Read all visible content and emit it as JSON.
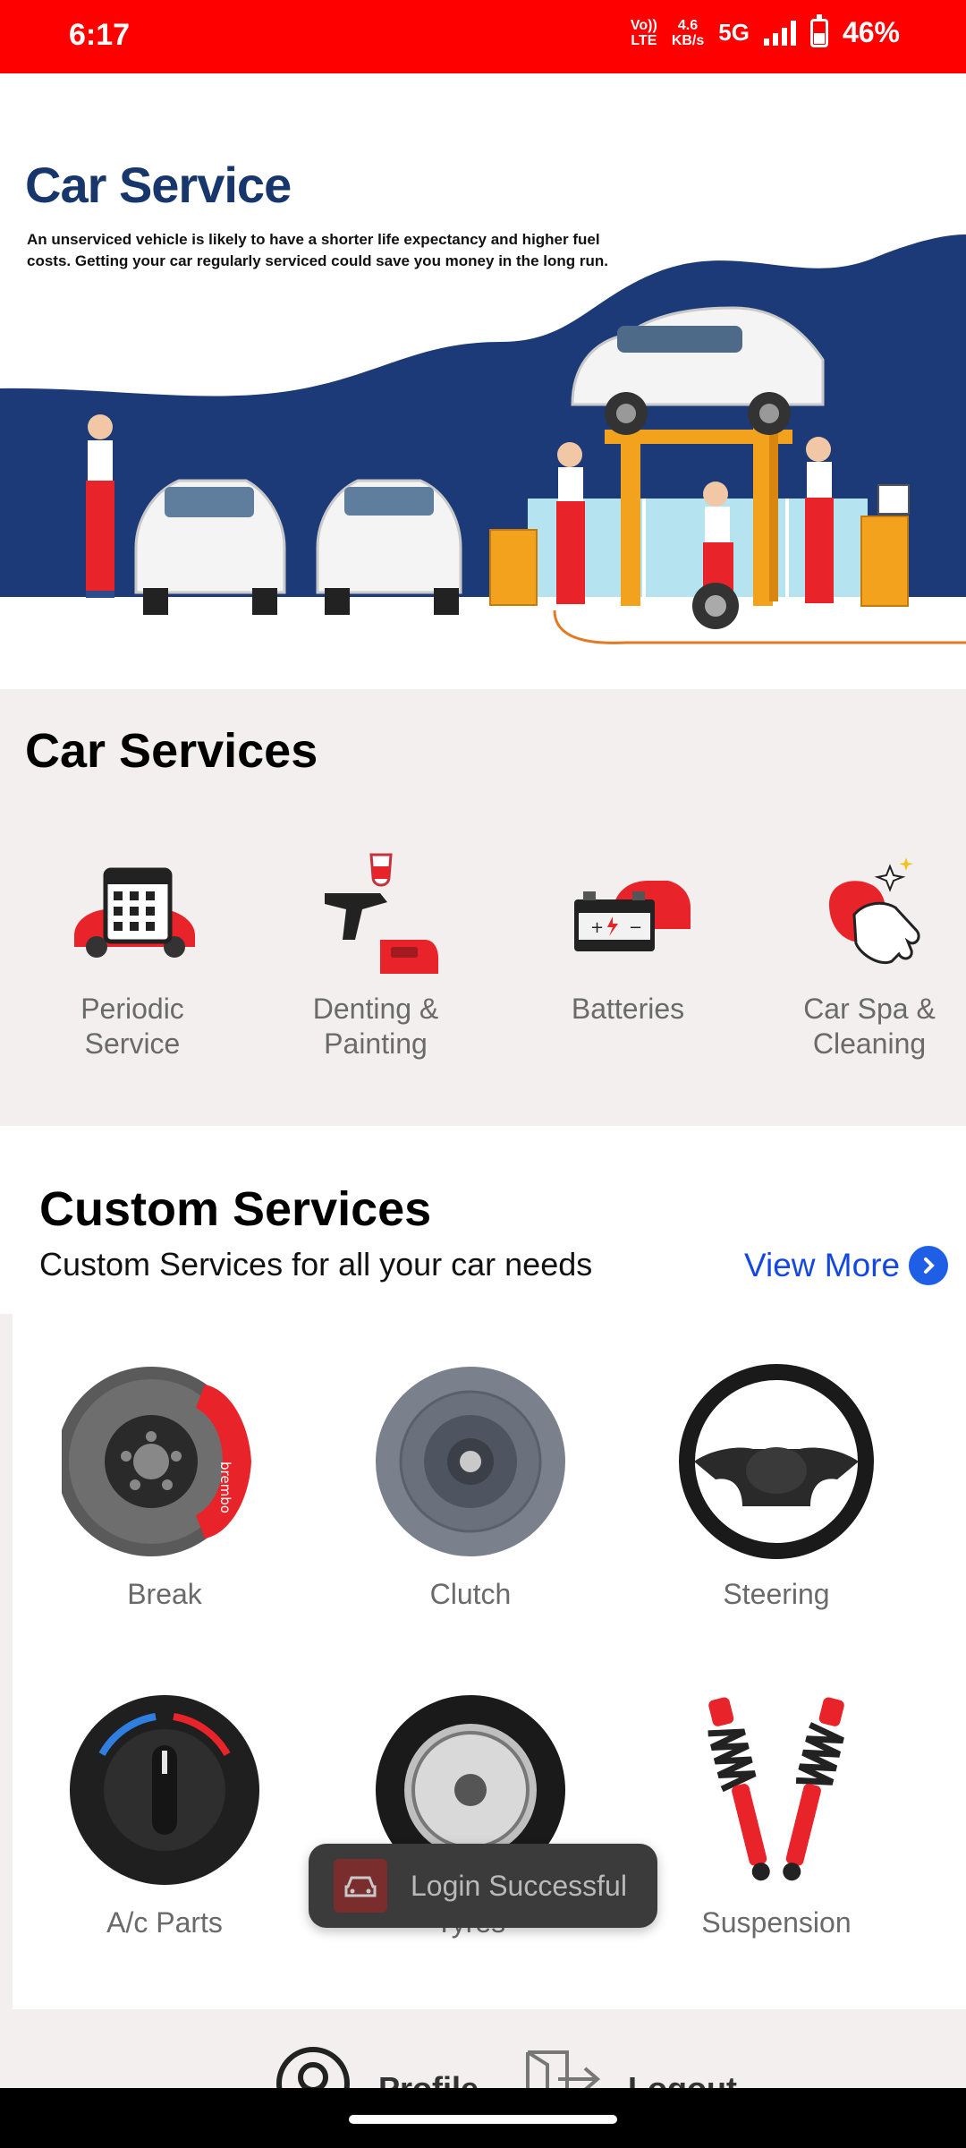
{
  "status_bar": {
    "time": "6:17",
    "volte_top": "Vo))",
    "volte_bottom": "LTE",
    "speed_top": "4.6",
    "speed_bottom": "KB/s",
    "network": "5G",
    "battery": "46%"
  },
  "banner": {
    "title": "Car Service",
    "subtitle": "An unserviced vehicle is likely to have a shorter life expectancy and higher fuel costs. Getting your car regularly serviced could save you money in the long run."
  },
  "car_services": {
    "title": "Car Services",
    "items": [
      {
        "label": "Periodic Service",
        "icon": "calendar-car-icon"
      },
      {
        "label": "Denting & Painting",
        "icon": "spray-gun-icon"
      },
      {
        "label": "Batteries",
        "icon": "battery-icon"
      },
      {
        "label": "Car Spa & Cleaning",
        "icon": "sponge-hand-icon"
      }
    ]
  },
  "custom_services": {
    "title": "Custom Services",
    "subtitle": "Custom Services for all your car needs",
    "view_more": "View More",
    "items": [
      {
        "label": "Break",
        "icon": "brake-disc-icon"
      },
      {
        "label": "Clutch",
        "icon": "clutch-plate-icon"
      },
      {
        "label": "Steering",
        "icon": "steering-wheel-icon"
      },
      {
        "label": "A/c Parts",
        "icon": "ac-knob-icon"
      },
      {
        "label": "Tyres",
        "icon": "tyre-icon"
      },
      {
        "label": "Suspension",
        "icon": "shock-absorber-icon"
      }
    ]
  },
  "bottom_nav": {
    "profile": "Profile",
    "logout": "Logout"
  },
  "toast": {
    "message": "Login Successful"
  },
  "colors": {
    "status_bar": "#ff0000",
    "brand_navy": "#17366b",
    "accent_red": "#e8232a",
    "link_blue": "#1448e0",
    "section_bg": "#f2efee"
  }
}
